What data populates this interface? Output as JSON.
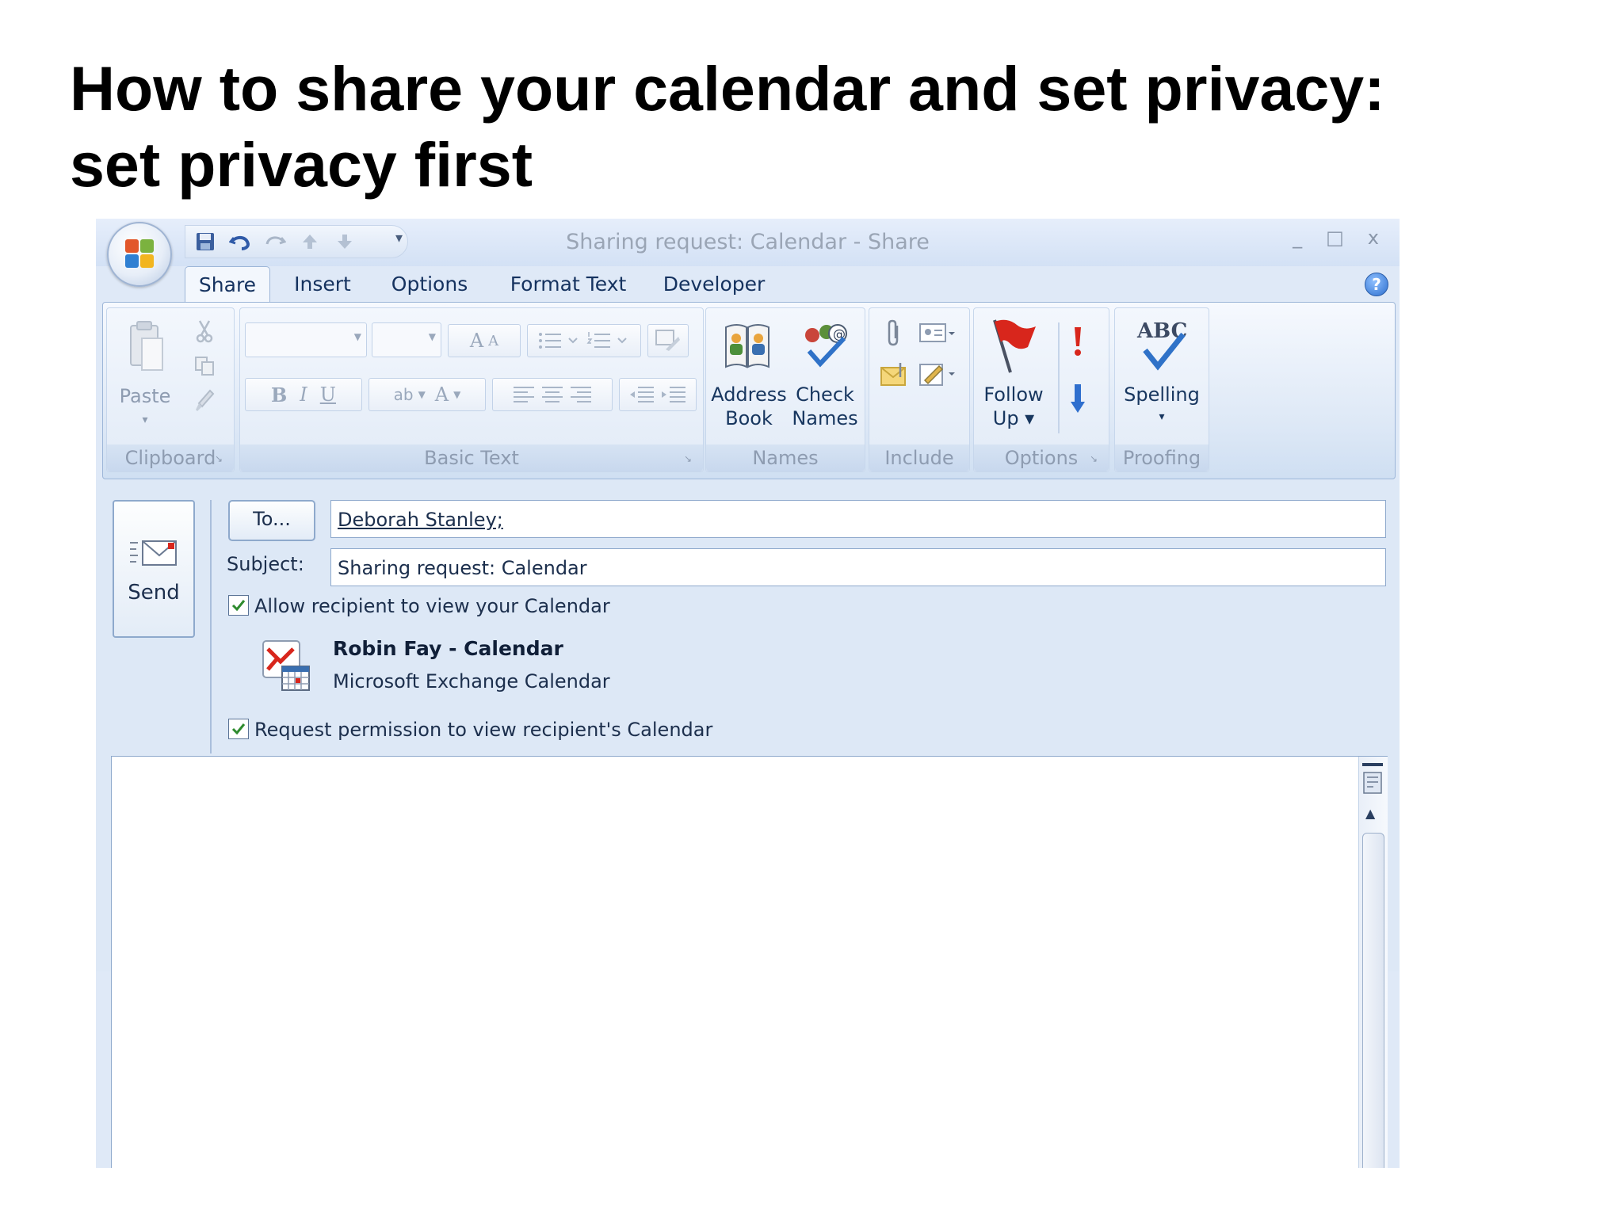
{
  "slide": {
    "title_line1": "How to share your calendar and set privacy:",
    "title_line2": "set privacy first"
  },
  "window": {
    "title": "Sharing request: Calendar - Share",
    "controls": {
      "minimize": "_",
      "maximize": "□",
      "close": "x"
    }
  },
  "quick_access": {
    "items": [
      "save-icon",
      "undo-icon",
      "redo-icon",
      "previous-item-icon",
      "next-item-icon"
    ],
    "customize": "▾"
  },
  "tabs": [
    {
      "label": "Share",
      "active": true
    },
    {
      "label": "Insert",
      "active": false
    },
    {
      "label": "Options",
      "active": false
    },
    {
      "label": "Format Text",
      "active": false
    },
    {
      "label": "Developer",
      "active": false
    }
  ],
  "help_icon": "?",
  "ribbon": {
    "clipboard": {
      "label": "Clipboard",
      "paste": "Paste"
    },
    "basic_text": {
      "label": "Basic Text",
      "grow_font": "A",
      "shrink_font": "A",
      "bold": "B",
      "italic": "I",
      "underline": "U",
      "highlight": "ab",
      "font_color": "A"
    },
    "names": {
      "label": "Names",
      "address_book_line1": "Address",
      "address_book_line2": "Book",
      "check_names_line1": "Check",
      "check_names_line2": "Names"
    },
    "include": {
      "label": "Include"
    },
    "options": {
      "label": "Options",
      "follow_up_line1": "Follow",
      "follow_up_line2": "Up ▾"
    },
    "proofing": {
      "label": "Proofing",
      "spelling": "Spelling",
      "spelling_arrow": "▾",
      "abc": "ABC"
    }
  },
  "compose": {
    "send_label": "Send",
    "to_button": "To...",
    "to_value": "Deborah Stanley;",
    "subject_label": "Subject:",
    "subject_value": "Sharing request: Calendar",
    "allow_view": {
      "label": "Allow recipient to view your Calendar",
      "checked": true
    },
    "calendar_name": "Robin Fay - Calendar",
    "calendar_type": "Microsoft Exchange Calendar",
    "request_permission": {
      "label": "Request permission to view recipient's Calendar",
      "checked": true
    }
  },
  "colors": {
    "ribbon_bg": "#dde8f6",
    "text_dark": "#15325f",
    "disabled_text": "#8e9cb1",
    "flag_red": "#d8261c",
    "check_green": "#2e8b2e"
  }
}
